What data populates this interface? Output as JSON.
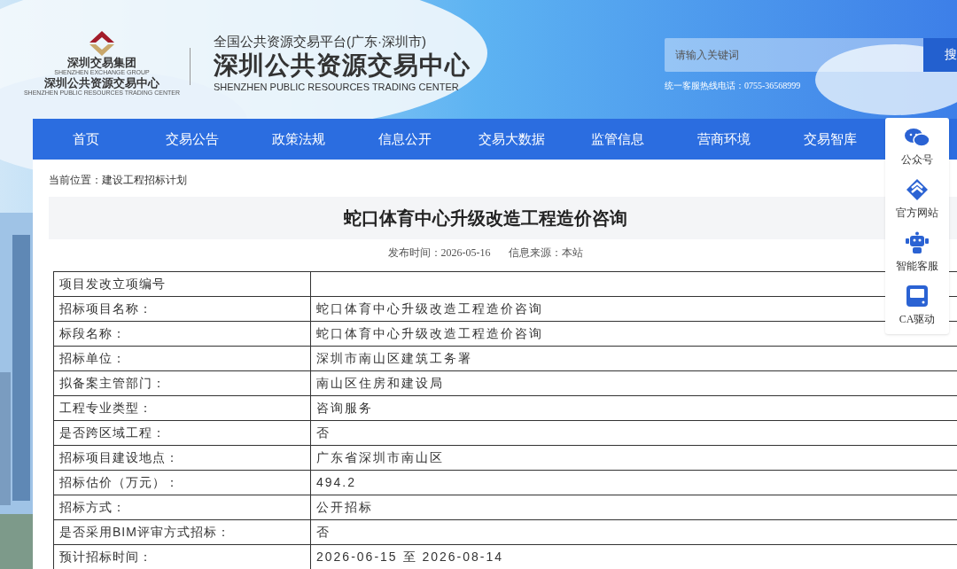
{
  "header": {
    "group_name": "深圳交易集团",
    "group_name_en": "SHENZHEN EXCHANGE GROUP",
    "center_name": "深圳公共资源交易中心",
    "center_name_en": "SHENZHEN PUBLIC RESOURCES TRADING CENTER",
    "platform": "全国公共资源交易平台(广东·深圳市)",
    "title": "深圳公共资源交易中心",
    "title_en": "SHENZHEN PUBLIC RESOURCES TRADING CENTER",
    "search": {
      "placeholder": "请输入关键词",
      "button": "搜"
    },
    "hotline": "统一客服热线电话：0755-36568999"
  },
  "nav": [
    "首页",
    "交易公告",
    "政策法规",
    "信息公开",
    "交易大数据",
    "监管信息",
    "营商环境",
    "交易智库"
  ],
  "breadcrumb": "当前位置：建设工程招标计划",
  "article": {
    "title": "蛇口体育中心升级改造工程造价咨询",
    "published": "发布时间：2026-05-16",
    "source": "信息来源：本站"
  },
  "table": {
    "rows": [
      {
        "label": "项目发改立项编号",
        "value": ""
      },
      {
        "label": "招标项目名称：",
        "value": "蛇口体育中心升级改造工程造价咨询"
      },
      {
        "label": "标段名称：",
        "value": "蛇口体育中心升级改造工程造价咨询"
      },
      {
        "label": "招标单位：",
        "value": "深圳市南山区建筑工务署"
      },
      {
        "label": "拟备案主管部门：",
        "value": "南山区住房和建设局"
      },
      {
        "label": "工程专业类型：",
        "value": "咨询服务"
      },
      {
        "label": "是否跨区域工程：",
        "value": "否"
      },
      {
        "label": "招标项目建设地点：",
        "value": "广东省深圳市南山区"
      },
      {
        "label": "招标估价（万元）：",
        "value": "494.2"
      },
      {
        "label": "招标方式：",
        "value": "公开招标"
      },
      {
        "label": "是否采用BIM评审方式招标：",
        "value": "否"
      },
      {
        "label": "预计招标时间：",
        "value": "2026-06-15 至 2026-08-14"
      }
    ]
  },
  "float_panel": [
    {
      "kind": "wechat",
      "label": "公众号"
    },
    {
      "kind": "logo",
      "label": "官方网站"
    },
    {
      "kind": "robot",
      "label": "智能客服"
    },
    {
      "kind": "ca",
      "label": "CA驱动"
    }
  ]
}
